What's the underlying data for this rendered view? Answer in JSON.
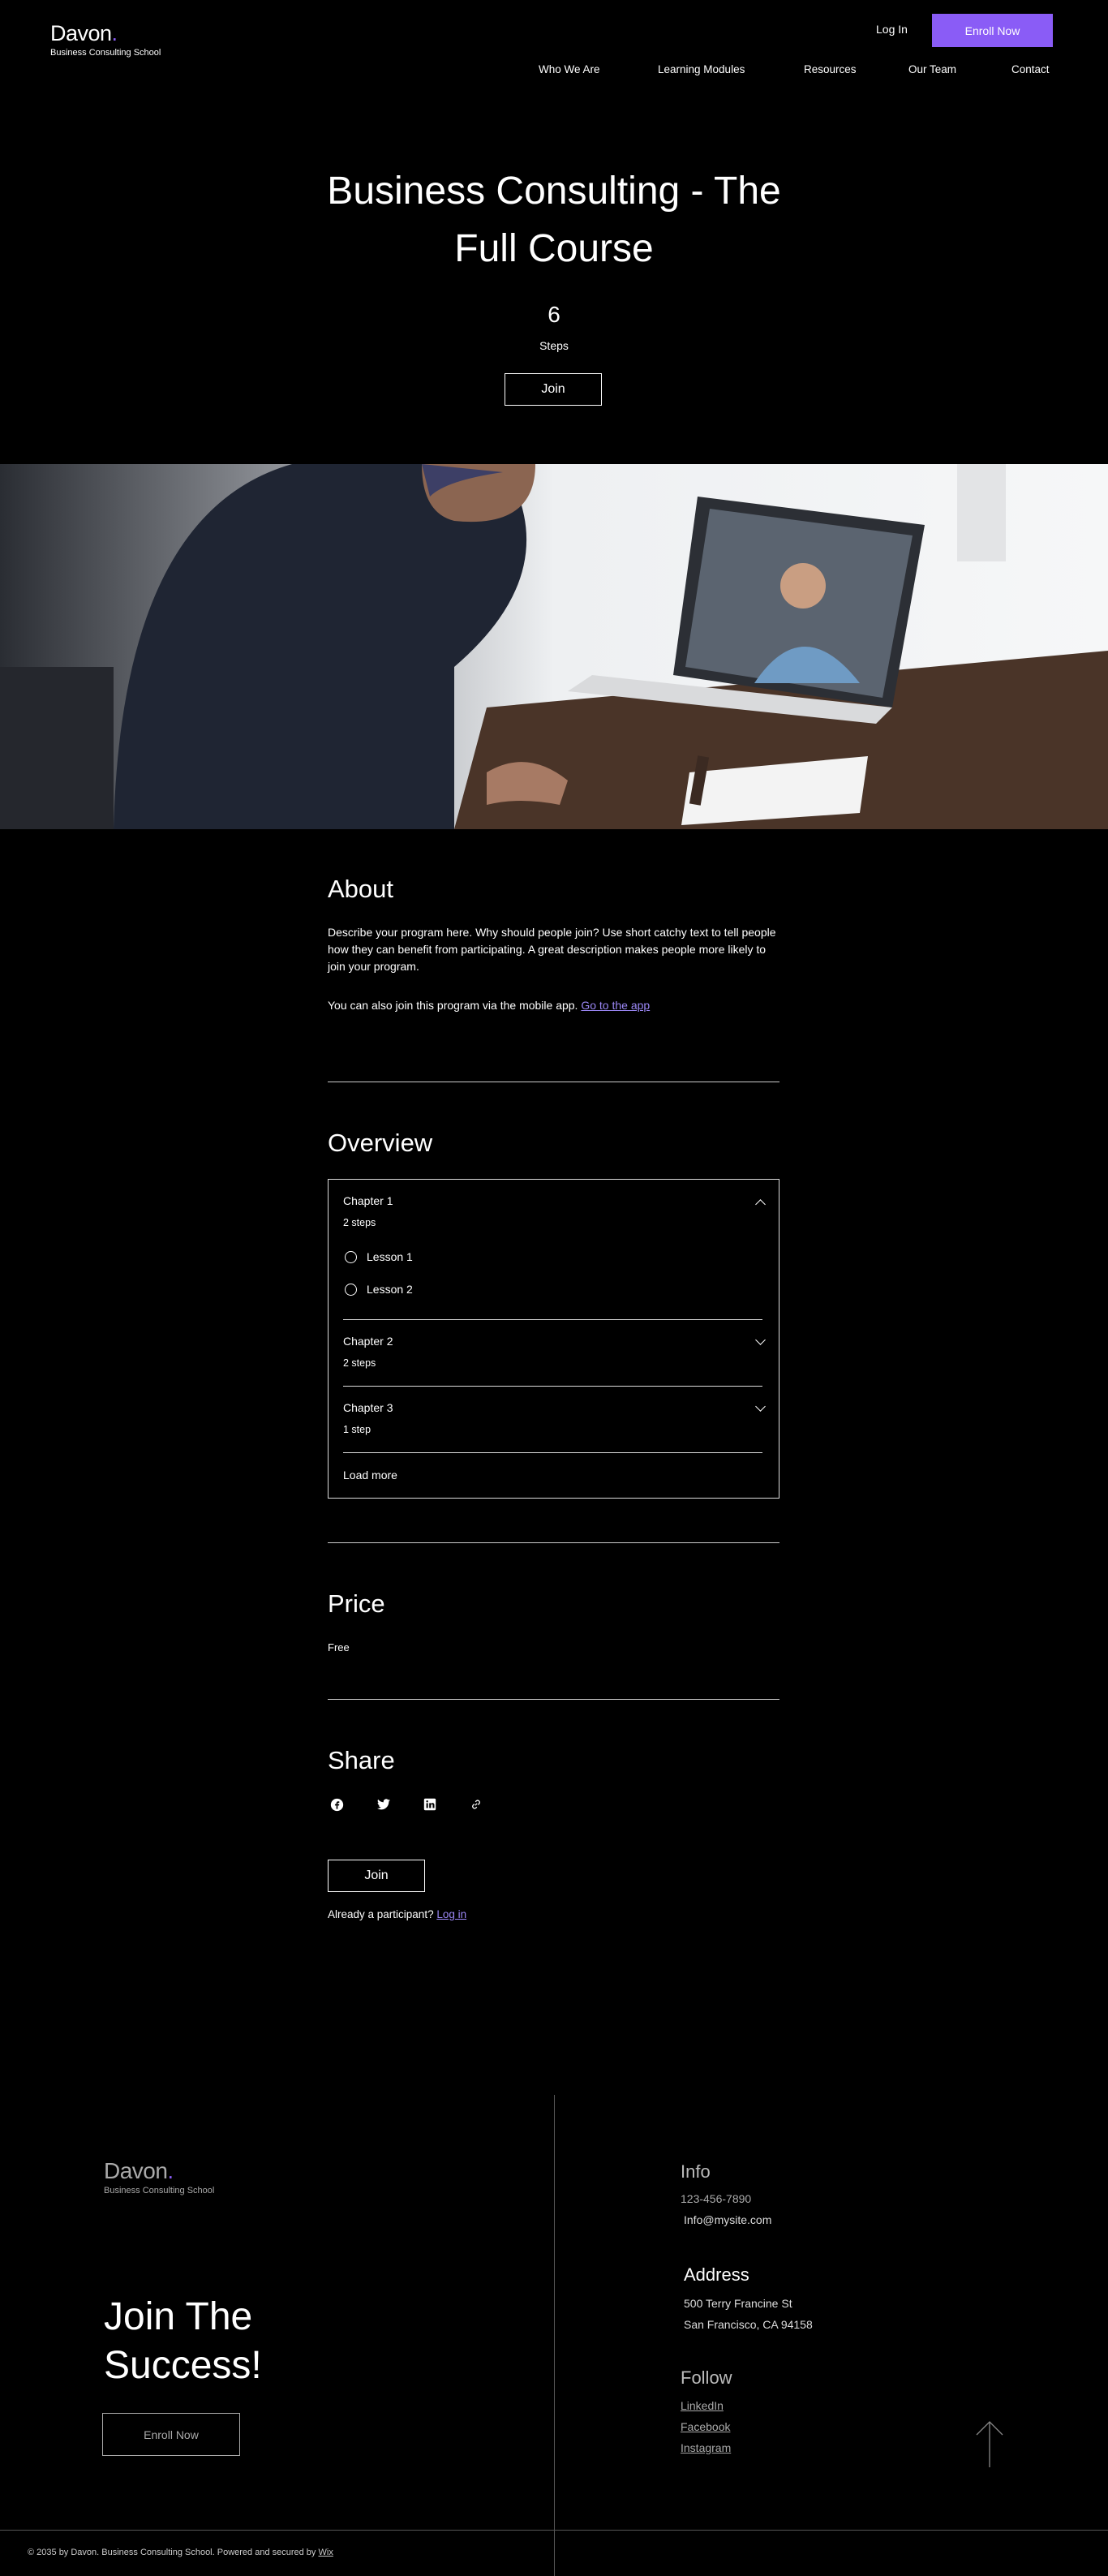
{
  "header": {
    "logo_word": "Davon",
    "logo_dot": ".",
    "logo_sub": "Business Consulting School",
    "login": "Log In",
    "enroll": "Enroll Now",
    "nav": [
      "Who We Are",
      "Learning Modules",
      "Resources",
      "Our Team",
      "Contact"
    ]
  },
  "hero": {
    "title_line1": "Business Consulting - The",
    "title_line2": "Full Course",
    "steps_count": "6",
    "steps_label": "Steps",
    "join": "Join"
  },
  "about": {
    "heading": "About",
    "description": "Describe your program here. Why should people join? Use short catchy text to tell people how they can benefit from participating. A great description makes people more likely to join your program.",
    "app_text": "You can also join this program via the mobile app.",
    "app_link": "Go to the app"
  },
  "overview": {
    "heading": "Overview",
    "chapters": [
      {
        "title": "Chapter 1",
        "sub": "2 steps",
        "lessons": [
          "Lesson 1",
          "Lesson 2"
        ]
      },
      {
        "title": "Chapter 2",
        "sub": "2 steps"
      },
      {
        "title": "Chapter 3",
        "sub": "1 step"
      }
    ],
    "load_more": "Load more"
  },
  "price": {
    "heading": "Price",
    "value": "Free"
  },
  "share": {
    "heading": "Share",
    "icons": [
      "facebook-icon",
      "twitter-icon",
      "linkedin-icon",
      "link-icon"
    ]
  },
  "cta": {
    "join": "Join",
    "already": "Already a participant?",
    "login": "Log in"
  },
  "footer": {
    "logo_word": "Davon",
    "logo_dot": ".",
    "logo_sub": "Business Consulting School",
    "join_line1": "Join The",
    "join_line2": "Success!",
    "enroll": "Enroll Now",
    "info_heading": "Info",
    "phone": "123-456-7890",
    "email": "Info@mysite.com",
    "address_heading": "Address",
    "address_line1": "500 Terry Francine St",
    "address_line2": "San Francisco, CA 94158",
    "follow_heading": "Follow",
    "links": [
      "LinkedIn",
      "Facebook",
      "Instagram"
    ],
    "copyright": "© 2035 by Davon. Business Consulting School. Powered and secured by",
    "wix": "Wix"
  },
  "colors": {
    "accent": "#8a5cf6",
    "background": "#000000"
  }
}
